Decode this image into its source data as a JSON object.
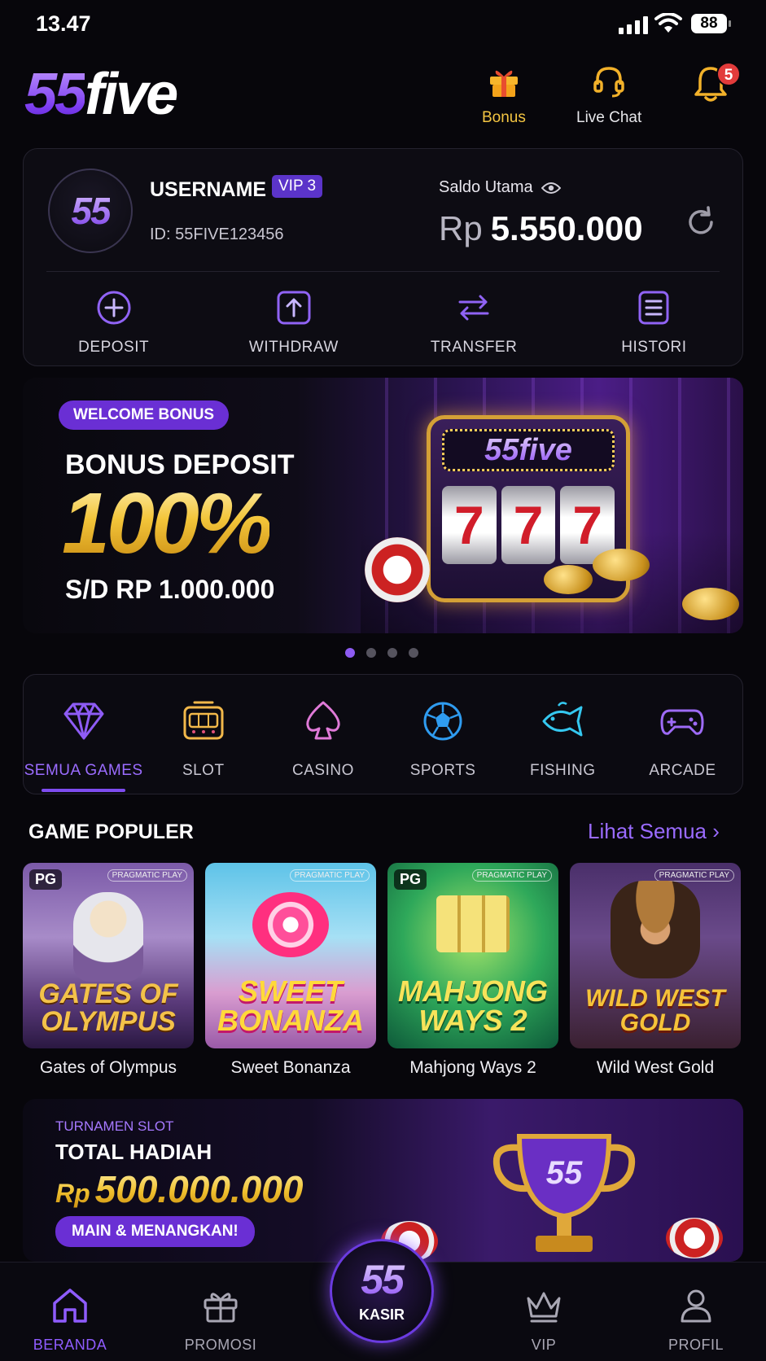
{
  "status_bar": {
    "time": "13.47",
    "battery": "88"
  },
  "header": {
    "logo_num": "55",
    "logo_word": "five",
    "bonus_label": "Bonus",
    "chat_label": "Live Chat",
    "notif_count": "5"
  },
  "account": {
    "avatar_text": "55",
    "username": "USERNAME",
    "vip": "VIP 3",
    "user_id": "ID: 55FIVE123456",
    "saldo_label": "Saldo Utama",
    "currency": "Rp",
    "balance": "5.550.000",
    "actions": [
      {
        "label": "DEPOSIT",
        "icon": "plus-circle-icon"
      },
      {
        "label": "WITHDRAW",
        "icon": "upload-icon"
      },
      {
        "label": "TRANSFER",
        "icon": "transfer-icon"
      },
      {
        "label": "HISTORI",
        "icon": "list-icon"
      }
    ]
  },
  "banner": {
    "tag": "WELCOME BONUS",
    "title": "BONUS DEPOSIT",
    "percent": "100%",
    "max": "S/D RP 1.000.000",
    "machine_logo": "55five",
    "reels": [
      "7",
      "7",
      "7"
    ],
    "slide_index": 1,
    "slide_count": 4
  },
  "categories": [
    {
      "label": "SEMUA GAMES",
      "icon": "diamond-icon",
      "active": true,
      "color": "#8e5cf5"
    },
    {
      "label": "SLOT",
      "icon": "slot-machine-icon",
      "active": false,
      "color": "#f2b84a"
    },
    {
      "label": "CASINO",
      "icon": "spade-icon",
      "active": false,
      "color": "#e07ad8"
    },
    {
      "label": "SPORTS",
      "icon": "soccer-ball-icon",
      "active": false,
      "color": "#2f9cf0"
    },
    {
      "label": "FISHING",
      "icon": "fish-icon",
      "active": false,
      "color": "#35c8f0"
    },
    {
      "label": "ARCADE",
      "icon": "gamepad-icon",
      "active": false,
      "color": "#9e6bf7"
    }
  ],
  "popular": {
    "title": "GAME POPULER",
    "more": "Lihat Semua",
    "games": [
      {
        "name": "Gates of Olympus",
        "art": "GATES OF OLYMPUS",
        "tag": "PG",
        "provider": "PRAGMATIC PLAY"
      },
      {
        "name": "Sweet Bonanza",
        "art": "SWEET BONANZA",
        "tag": "",
        "provider": "PRAGMATIC PLAY"
      },
      {
        "name": "Mahjong Ways 2",
        "art": "MAHJONG WAYS 2",
        "tag": "PG",
        "provider": "PRAGMATIC PLAY"
      },
      {
        "name": "Wild West Gold",
        "art": "WILD WEST GOLD",
        "tag": "",
        "provider": "PRAGMATIC PLAY"
      }
    ]
  },
  "tournament": {
    "label": "TURNAMEN SLOT",
    "title": "TOTAL HADIAH",
    "currency": "Rp",
    "amount": "500.000.000",
    "cta": "MAIN & MENANGKAN!",
    "trophy_text": "55"
  },
  "nav": {
    "home": "BERANDA",
    "promo": "PROMOSI",
    "kasir_num": "55",
    "kasir": "KASIR",
    "vip": "VIP",
    "profile": "PROFIL"
  }
}
